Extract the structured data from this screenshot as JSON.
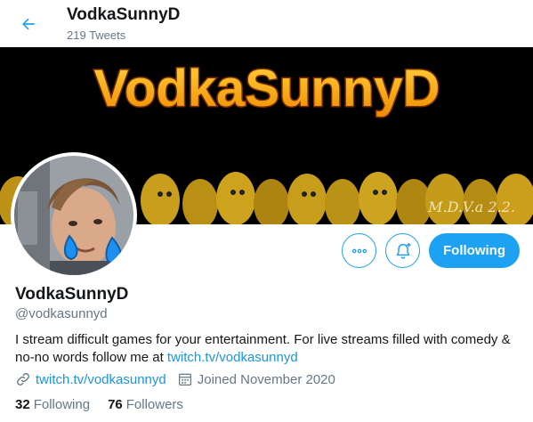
{
  "header": {
    "name": "VodkaSunnyD",
    "tweet_count": "219 Tweets"
  },
  "banner": {
    "title_text": "VodkaSunnyD",
    "signature": "M.D.V.a 2.2."
  },
  "actions": {
    "more_icon": "more-dots-icon",
    "notify_icon": "bell-plus-icon",
    "follow_label": "Following"
  },
  "profile": {
    "name": "VodkaSunnyD",
    "handle": "@vodkasunnyd",
    "bio_text": "I stream difficult games for your entertainment. For live streams filled with comedy & no-no words follow me at ",
    "bio_link": "twitch.tv/vodkasunnyd",
    "website": "twitch.tv/vodkasunnyd",
    "joined": "Joined November 2020"
  },
  "stats": {
    "following_count": "32",
    "following_label": "Following",
    "followers_count": "76",
    "followers_label": "Followers"
  },
  "colors": {
    "accent": "#1da1f2",
    "link": "#1b95e0",
    "muted": "#657786",
    "banner_text": "#f7a500"
  }
}
